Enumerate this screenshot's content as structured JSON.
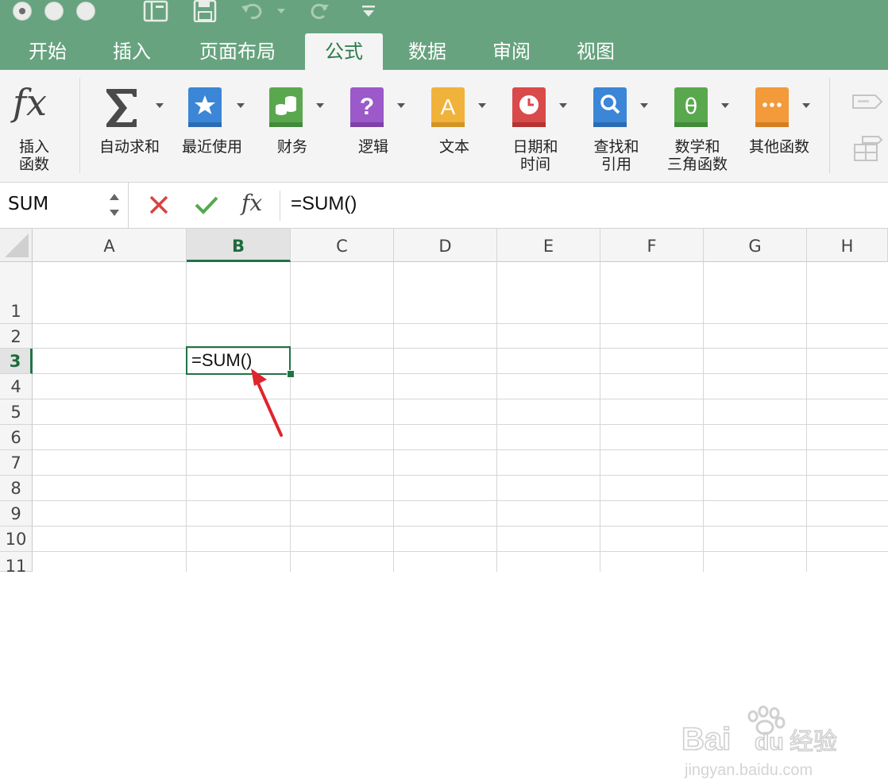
{
  "quick_access": {
    "icons": [
      "notebook-icon",
      "save-icon",
      "undo-icon",
      "redo-icon",
      "customize-icon"
    ]
  },
  "tabs": [
    "开始",
    "插入",
    "页面布局",
    "公式",
    "数据",
    "审阅",
    "视图"
  ],
  "active_tab": "公式",
  "ribbon": {
    "insert_function": {
      "label_line1": "插入",
      "label_line2": "函数"
    },
    "buttons": [
      {
        "id": "autosum",
        "line1": "自动求和",
        "line2": "",
        "icon": "sigma-icon",
        "color": "#4a4a4a"
      },
      {
        "id": "recent",
        "line1": "最近使用",
        "line2": "",
        "icon": "star-book-icon",
        "color": "#3b86d6"
      },
      {
        "id": "finance",
        "line1": "财务",
        "line2": "",
        "icon": "coins-book-icon",
        "color": "#5aa84e"
      },
      {
        "id": "logic",
        "line1": "逻辑",
        "line2": "",
        "icon": "question-book-icon",
        "color": "#9b59c9"
      },
      {
        "id": "text",
        "line1": "文本",
        "line2": "",
        "icon": "letter-a-book-icon",
        "color": "#f0b23a"
      },
      {
        "id": "datetime",
        "line1": "日期和",
        "line2": "时间",
        "icon": "clock-book-icon",
        "color": "#d94a4a"
      },
      {
        "id": "lookup",
        "line1": "查找和",
        "line2": "引用",
        "icon": "magnifier-book-icon",
        "color": "#3b86d6"
      },
      {
        "id": "math",
        "line1": "数学和",
        "line2": "三角函数",
        "icon": "theta-book-icon",
        "color": "#5aa84e"
      },
      {
        "id": "other",
        "line1": "其他函数",
        "line2": "",
        "icon": "more-book-icon",
        "color": "#f39a3a"
      }
    ]
  },
  "formula_bar": {
    "name_box": "SUM",
    "fx": "fx",
    "formula": "=SUM()"
  },
  "columns": [
    "A",
    "B",
    "C",
    "D",
    "E",
    "F",
    "G",
    "H"
  ],
  "selected_column": "B",
  "rows": [
    "1",
    "2",
    "3",
    "4",
    "5",
    "6",
    "7",
    "8",
    "9",
    "10",
    "11"
  ],
  "selected_row": "3",
  "active_cell": {
    "ref": "B3",
    "value": "=SUM()"
  },
  "colors": {
    "accent": "#217346",
    "titlebar": "#67a37f",
    "arrow": "#e0242c"
  }
}
